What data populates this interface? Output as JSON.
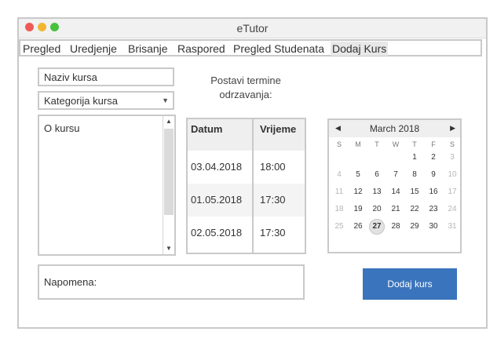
{
  "window": {
    "title": "eTutor"
  },
  "menu": {
    "items": [
      {
        "label": "Pregled"
      },
      {
        "label": "Uredjenje"
      },
      {
        "label": "Brisanje"
      },
      {
        "label": "Raspored"
      },
      {
        "label": "Pregled Studenata"
      },
      {
        "label": "Dodaj Kurs",
        "active": true
      }
    ]
  },
  "form": {
    "course_name_placeholder": "Naziv kursa",
    "category_placeholder": "Kategorija kursa",
    "about_placeholder": "O kursu",
    "note_placeholder": "Napomena:",
    "schedule_label_line1": "Postavi termine",
    "schedule_label_line2": "odrzavanja:",
    "submit_label": "Dodaj kurs"
  },
  "schedule_table": {
    "headers": [
      "Datum",
      "Vrijeme"
    ],
    "rows": [
      [
        "03.04.2018",
        "18:00"
      ],
      [
        "01.05.2018",
        "17:30"
      ],
      [
        "02.05.2018",
        "17:30"
      ]
    ]
  },
  "calendar": {
    "month_label": "March 2018",
    "prev_icon": "triangle-left-icon",
    "next_icon": "triangle-right-icon",
    "weekdays": [
      "S",
      "M",
      "T",
      "W",
      "T",
      "F",
      "S"
    ],
    "weeks": [
      [
        "",
        "",
        "",
        "",
        "1",
        "2",
        "3"
      ],
      [
        "4",
        "5",
        "6",
        "7",
        "8",
        "9",
        "10"
      ],
      [
        "11",
        "12",
        "13",
        "14",
        "15",
        "16",
        "17"
      ],
      [
        "18",
        "19",
        "20",
        "21",
        "22",
        "23",
        "24"
      ],
      [
        "25",
        "26",
        "27",
        "28",
        "29",
        "30",
        "31"
      ]
    ],
    "selected_day": "27"
  },
  "colors": {
    "accent": "#3a74bc",
    "border": "#c9c9c9",
    "dot_red": "#ee5a55",
    "dot_yellow": "#f0b532",
    "dot_green": "#46c23c"
  }
}
